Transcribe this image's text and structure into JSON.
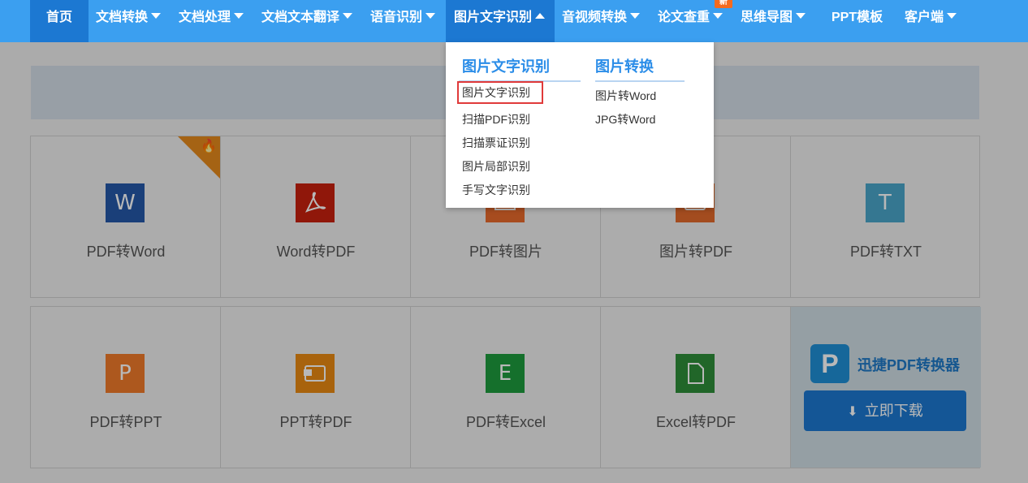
{
  "nav": {
    "items": [
      {
        "label": "首页"
      },
      {
        "label": "文档转换"
      },
      {
        "label": "文档处理"
      },
      {
        "label": "文档文本翻译"
      },
      {
        "label": "语音识别"
      },
      {
        "label": "图片文字识别"
      },
      {
        "label": "音视频转换"
      },
      {
        "label": "论文查重"
      },
      {
        "label": "思维导图"
      },
      {
        "label": "PPT模板"
      },
      {
        "label": "客户端"
      }
    ],
    "new_badge": "新"
  },
  "tiles_row1": [
    {
      "label": "PDF转Word",
      "icon": "W",
      "color": "#2458a8"
    },
    {
      "label": "Word转PDF",
      "icon": "pdf-icon",
      "color": "#c8200e"
    },
    {
      "label": "PDF转图片",
      "icon": "image-icon",
      "color": "#e86a2c"
    },
    {
      "label": "图片转PDF",
      "icon": "image-pdf-icon",
      "color": "#e26a2c"
    },
    {
      "label": "PDF转TXT",
      "icon": "T",
      "color": "#4aa6c9"
    }
  ],
  "tiles_row2": [
    {
      "label": "PDF转PPT",
      "icon": "P",
      "color": "#f07a2a"
    },
    {
      "label": "PPT转PDF",
      "icon": "ppt-pdf-icon",
      "color": "#e98a12"
    },
    {
      "label": "PDF转Excel",
      "icon": "E",
      "color": "#1e9b3e"
    },
    {
      "label": "Excel转PDF",
      "icon": "excel-pdf-icon",
      "color": "#2e8e3a"
    }
  ],
  "promo": {
    "logo": "P",
    "title": "迅捷PDF转换器",
    "button": "立即下载"
  },
  "dropdown": {
    "col1": {
      "heading": "图片文字识别",
      "links": [
        "图片文字识别",
        "扫描PDF识别",
        "扫描票证识别",
        "图片局部识别",
        "手写文字识别"
      ]
    },
    "col2": {
      "heading": "图片转换",
      "links": [
        "图片转Word",
        "JPG转Word"
      ]
    }
  },
  "colors": {
    "nav_bg": "#3b9ff0",
    "nav_active": "#1c78d2",
    "accent": "#2b8de8",
    "highlight_border": "#e03a3a"
  }
}
